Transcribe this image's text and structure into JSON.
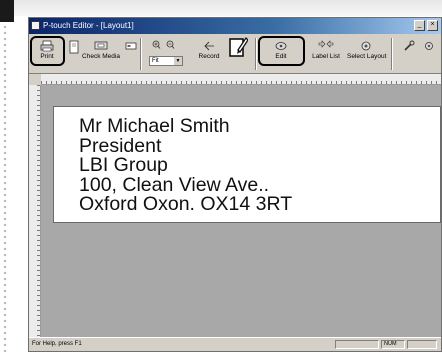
{
  "window": {
    "title": "P-touch Editor - [Layout1]"
  },
  "toolbar": {
    "buttons": [
      {
        "label": "Print"
      },
      {
        "label": "Check Media"
      },
      {
        "label": "Record"
      },
      {
        "label": "Edit"
      },
      {
        "label": "Label List"
      },
      {
        "label": "Select Layout"
      }
    ],
    "zoom_value": "Fit"
  },
  "label": {
    "lines": [
      "Mr Michael Smith",
      "President",
      "LBI Group",
      "100, Clean View Ave..",
      "Oxford Oxon. OX14 3RT"
    ]
  },
  "statusbar": {
    "help_text": "For Help, press F1",
    "num_indicator": "NUM"
  }
}
